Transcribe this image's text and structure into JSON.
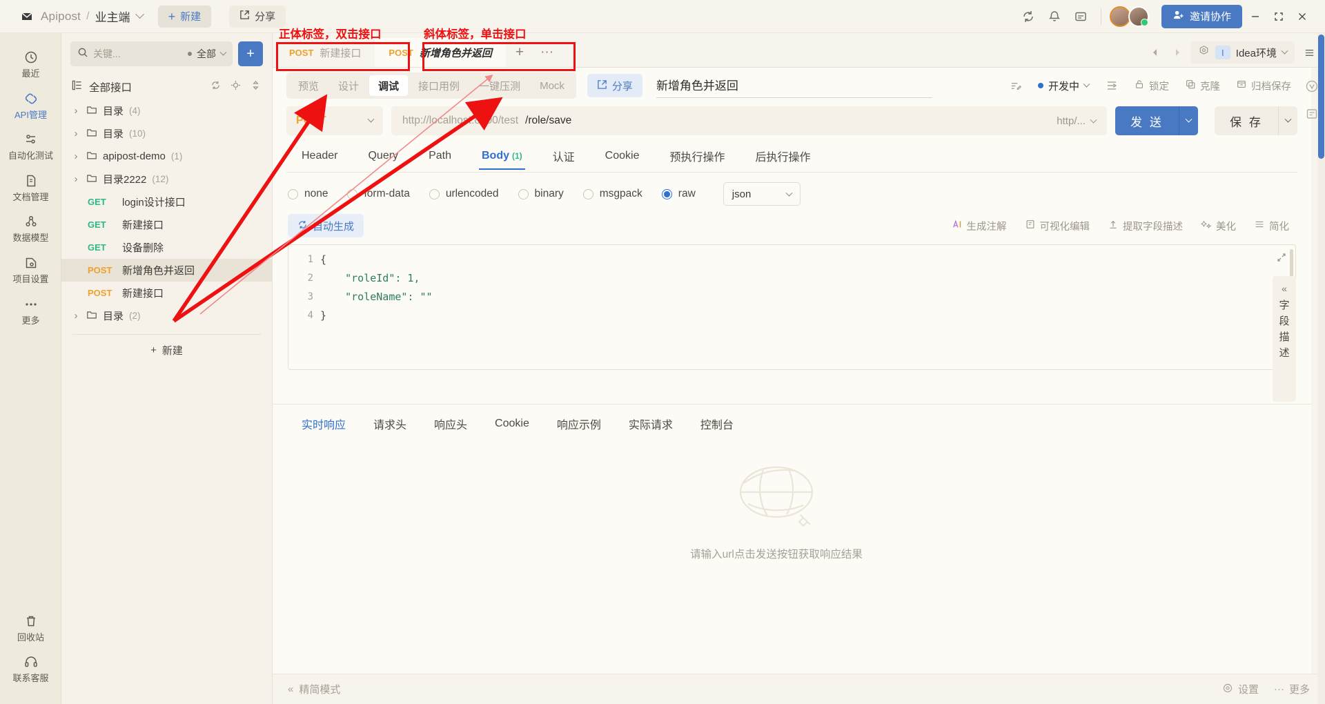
{
  "header": {
    "brand": "Apipost",
    "separator": "/",
    "project": "业主端",
    "new_label": "新建",
    "share_label": "分享",
    "invite_label": "邀请协作",
    "icons": [
      "sync-icon",
      "bell-icon",
      "message-icon"
    ],
    "window_controls": [
      "minimize",
      "maximize",
      "close"
    ]
  },
  "rail": {
    "items": [
      {
        "label": "最近",
        "icon": "clock-icon",
        "active": false
      },
      {
        "label": "API管理",
        "icon": "api-icon",
        "active": true
      },
      {
        "label": "自动化测试",
        "icon": "automation-icon",
        "active": false
      },
      {
        "label": "文档管理",
        "icon": "document-icon",
        "active": false
      },
      {
        "label": "数据模型",
        "icon": "model-icon",
        "active": false
      },
      {
        "label": "项目设置",
        "icon": "settings-icon",
        "active": false
      },
      {
        "label": "更多",
        "icon": "more-icon",
        "active": false
      }
    ],
    "bottom_items": [
      {
        "label": "回收站",
        "icon": "trash-icon"
      },
      {
        "label": "联系客服",
        "icon": "headset-icon"
      }
    ]
  },
  "sidebar": {
    "search_placeholder": "关键...",
    "filter_label": "全部",
    "add_button": "+",
    "all_apis_label": "全部接口",
    "all_apis_tools": [
      "refresh-icon",
      "locate-icon",
      "sort-icon"
    ],
    "new_label": "新建",
    "tree": [
      {
        "type": "folder",
        "label": "目录",
        "count": "(4)"
      },
      {
        "type": "folder",
        "label": "目录",
        "count": "(10)"
      },
      {
        "type": "folder",
        "label": "apipost-demo",
        "count": "(1)"
      },
      {
        "type": "folder",
        "label": "目录2222",
        "count": "(12)"
      },
      {
        "type": "api",
        "method": "GET",
        "label": "login设计接口",
        "selected": false
      },
      {
        "type": "api",
        "method": "GET",
        "label": "新建接口",
        "selected": false
      },
      {
        "type": "api",
        "method": "GET",
        "label": "设备删除",
        "selected": false
      },
      {
        "type": "api",
        "method": "POST",
        "label": "新增角色并返回",
        "selected": true
      },
      {
        "type": "api",
        "method": "POST",
        "label": "新建接口",
        "selected": false
      },
      {
        "type": "folder",
        "label": "目录",
        "count": "(2)"
      }
    ]
  },
  "tabstrip": {
    "tabs": [
      {
        "method": "POST",
        "title": "新建接口",
        "active": false,
        "italic": false
      },
      {
        "method": "POST",
        "title": "新增角色并返回",
        "active": true,
        "italic": true
      }
    ],
    "add_tab": "+",
    "more_tabs": "···",
    "env_name": "Idea环境",
    "env_badge": "I"
  },
  "subhead": {
    "segments": [
      {
        "label": "预览",
        "on": false
      },
      {
        "label": "设计",
        "on": false
      },
      {
        "label": "调试",
        "on": true
      },
      {
        "label": "接口用例",
        "on": false
      },
      {
        "label": "一键压测",
        "on": false
      },
      {
        "label": "Mock",
        "on": false
      }
    ],
    "share_label": "分享",
    "api_title": "新增角色并返回",
    "right_actions": [
      {
        "label": "",
        "icon": "note-icon"
      },
      {
        "label": "开发中",
        "icon": "status-dot"
      },
      {
        "label": "",
        "icon": "indent-icon"
      },
      {
        "label": "锁定",
        "icon": "lock-icon"
      },
      {
        "label": "克隆",
        "icon": "clone-icon"
      },
      {
        "label": "归档保存",
        "icon": "archive-icon"
      }
    ]
  },
  "request": {
    "method": "POST",
    "url_prefix": "http://localhost:8000/test",
    "url_path": "/role/save",
    "url_right_label": "http/...",
    "send_label": "发 送",
    "save_label": "保 存",
    "param_tabs": [
      {
        "label": "Header",
        "on": false,
        "count": ""
      },
      {
        "label": "Query",
        "on": false,
        "count": ""
      },
      {
        "label": "Path",
        "on": false,
        "count": ""
      },
      {
        "label": "Body",
        "on": true,
        "count": "(1)"
      },
      {
        "label": "认证",
        "on": false,
        "count": ""
      },
      {
        "label": "Cookie",
        "on": false,
        "count": ""
      },
      {
        "label": "预执行操作",
        "on": false,
        "count": ""
      },
      {
        "label": "后执行操作",
        "on": false,
        "count": ""
      }
    ],
    "body_types": [
      {
        "label": "none",
        "on": false
      },
      {
        "label": "form-data",
        "on": false
      },
      {
        "label": "urlencoded",
        "on": false
      },
      {
        "label": "binary",
        "on": false
      },
      {
        "label": "msgpack",
        "on": false
      },
      {
        "label": "raw",
        "on": true
      }
    ],
    "raw_format": "json",
    "autogen_label": "自动生成",
    "editor_actions": [
      {
        "label": "生成注解",
        "icon": "ai-icon"
      },
      {
        "label": "可视化编辑",
        "icon": "visual-icon"
      },
      {
        "label": "提取字段描述",
        "icon": "extract-icon"
      },
      {
        "label": "美化",
        "icon": "beautify-icon"
      },
      {
        "label": "简化",
        "icon": "simplify-icon"
      }
    ],
    "code_lines": [
      {
        "n": "1",
        "text": "{"
      },
      {
        "n": "2",
        "text": "    \"roleId\": 1,"
      },
      {
        "n": "3",
        "text": "    \"roleName\": \"\""
      },
      {
        "n": "4",
        "text": "}"
      }
    ],
    "field_desc_label": "字段描述"
  },
  "response": {
    "tabs": [
      {
        "label": "实时响应",
        "on": true
      },
      {
        "label": "请求头",
        "on": false
      },
      {
        "label": "响应头",
        "on": false
      },
      {
        "label": "Cookie",
        "on": false
      },
      {
        "label": "响应示例",
        "on": false
      },
      {
        "label": "实际请求",
        "on": false
      },
      {
        "label": "控制台",
        "on": false
      }
    ],
    "empty_message": "请输入url点击发送按钮获取响应结果"
  },
  "bottombar": {
    "simple_mode": "精简模式",
    "settings": "设置",
    "more": "更多"
  },
  "annotations": {
    "left_note": "正体标签，双击接口",
    "right_note": "斜体标签，单击接口",
    "color": "#ee1111"
  }
}
